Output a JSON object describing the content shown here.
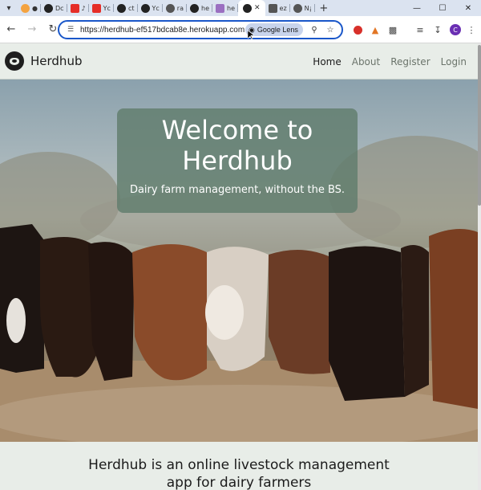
{
  "browser": {
    "tabs": [
      {
        "label": "●",
        "color": "#f4a340"
      },
      {
        "label": "Dc",
        "color": "#222"
      },
      {
        "label": "♪",
        "color": "#e52d27"
      },
      {
        "label": "Yc",
        "color": "#e52d27"
      },
      {
        "label": "ct",
        "color": "#222"
      },
      {
        "label": "Yc",
        "color": "#222"
      },
      {
        "label": "ra",
        "color": "#555"
      },
      {
        "label": "he",
        "color": "#222"
      },
      {
        "label": "he",
        "color": "#9b6fc1"
      },
      {
        "label": "",
        "color": "#222",
        "active": true
      },
      {
        "label": "ez",
        "color": "#555"
      },
      {
        "label": "N¡",
        "color": "#555"
      }
    ],
    "url": "https://herdhub-ef517bdcab8e.herokuapp.com",
    "lens_label": "Google Lens",
    "profile_initial": "C"
  },
  "site": {
    "brand": "Herdhub",
    "nav": [
      {
        "label": "Home",
        "active": true
      },
      {
        "label": "About"
      },
      {
        "label": "Register"
      },
      {
        "label": "Login"
      }
    ]
  },
  "hero": {
    "title": "Welcome to Herdhub",
    "subtitle": "Dairy farm management, without the BS."
  },
  "about": {
    "text": "Herdhub is an online livestock management app for dairy farmers"
  },
  "colors": {
    "accent": "#1a57c9",
    "page_bg": "#e8ede8",
    "hero_card": "#607c6c"
  }
}
